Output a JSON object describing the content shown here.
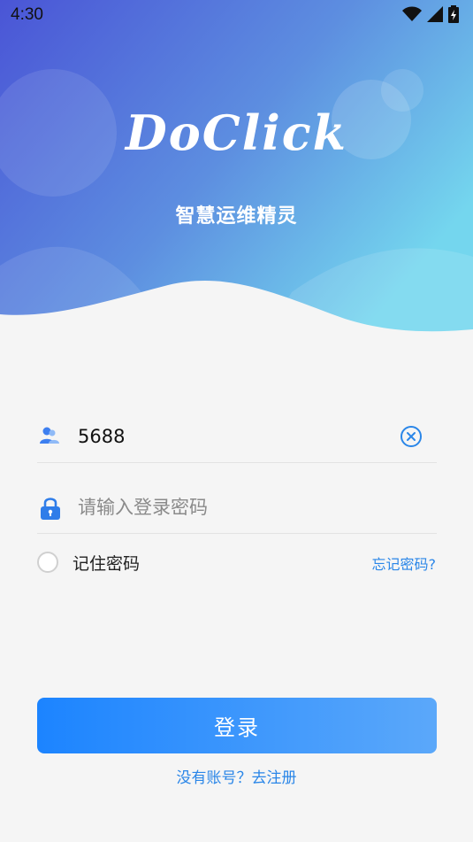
{
  "status_bar": {
    "time": "4:30"
  },
  "header": {
    "logo_text": "DoClick",
    "subtitle": "智慧运维精灵"
  },
  "form": {
    "username": {
      "value": "5688"
    },
    "password": {
      "placeholder": "请输入登录密码"
    },
    "remember_label": "记住密码",
    "remember_checked": false,
    "forgot_label": "忘记密码?",
    "login_label": "登录",
    "register_label": "没有账号？去注册"
  },
  "colors": {
    "accent": "#2a86e8",
    "button_start": "#1c84ff",
    "button_end": "#5ba8fa",
    "header_start": "#4a5bd8",
    "header_end": "#72d3ee"
  }
}
